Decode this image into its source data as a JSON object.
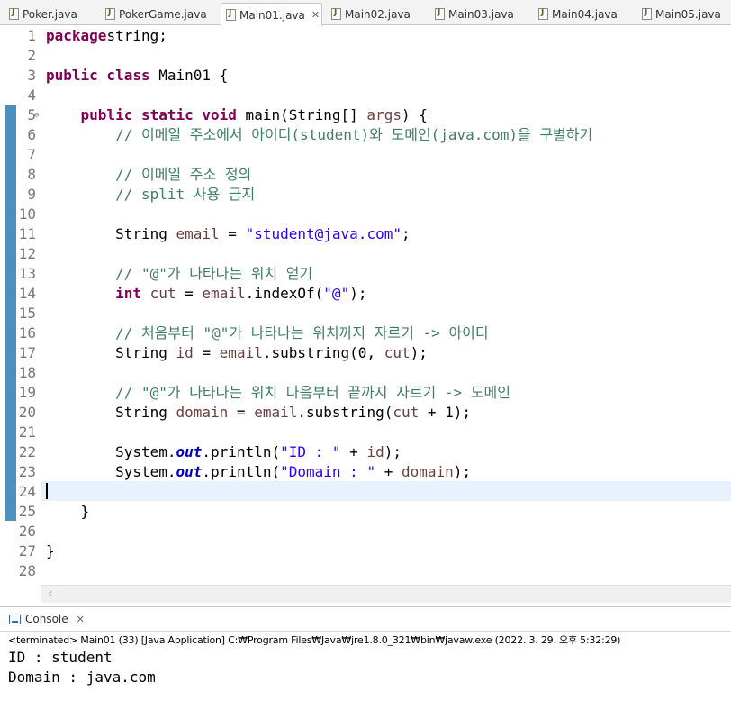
{
  "tabs": [
    {
      "label": "Poker.java",
      "active": false
    },
    {
      "label": "PokerGame.java",
      "active": false
    },
    {
      "label": "Main01.java",
      "active": true
    },
    {
      "label": "Main02.java",
      "active": false
    },
    {
      "label": "Main03.java",
      "active": false
    },
    {
      "label": "Main04.java",
      "active": false
    },
    {
      "label": "Main05.java",
      "active": false
    }
  ],
  "tab_close_glyph": "✕",
  "editor": {
    "fold_marker": "⊖",
    "lines": [
      {
        "n": "1",
        "t": [
          [
            "kw",
            "package"
          ],
          [
            "",
            "string;"
          ]
        ]
      },
      {
        "n": "2",
        "t": []
      },
      {
        "n": "3",
        "t": [
          [
            "kw",
            "public class"
          ],
          [
            "",
            " Main01 {"
          ]
        ]
      },
      {
        "n": "4",
        "t": []
      },
      {
        "n": "5",
        "fold": true,
        "t": [
          [
            "",
            "    "
          ],
          [
            "kw",
            "public static void"
          ],
          [
            "",
            " main(String[] "
          ],
          [
            "vr",
            "args"
          ],
          [
            "",
            ") {"
          ]
        ]
      },
      {
        "n": "6",
        "t": [
          [
            "",
            "        "
          ],
          [
            "cm",
            "// 이메일 주소에서 아이디(student)와 도메인(java.com)을 구별하기"
          ]
        ]
      },
      {
        "n": "7",
        "t": []
      },
      {
        "n": "8",
        "t": [
          [
            "",
            "        "
          ],
          [
            "cm",
            "// 이메일 주소 정의"
          ]
        ]
      },
      {
        "n": "9",
        "t": [
          [
            "",
            "        "
          ],
          [
            "cm",
            "// split 사용 금지"
          ]
        ]
      },
      {
        "n": "10",
        "t": []
      },
      {
        "n": "11",
        "t": [
          [
            "",
            "        String "
          ],
          [
            "vr",
            "email"
          ],
          [
            "",
            " = "
          ],
          [
            "st",
            "\"student@java.com\""
          ],
          [
            "",
            ";"
          ]
        ]
      },
      {
        "n": "12",
        "t": []
      },
      {
        "n": "13",
        "t": [
          [
            "",
            "        "
          ],
          [
            "cm",
            "// \"@\"가 나타나는 위치 얻기"
          ]
        ]
      },
      {
        "n": "14",
        "t": [
          [
            "",
            "        "
          ],
          [
            "kw",
            "int"
          ],
          [
            "",
            " "
          ],
          [
            "vr",
            "cut"
          ],
          [
            "",
            " = "
          ],
          [
            "vr",
            "email"
          ],
          [
            "",
            ".indexOf("
          ],
          [
            "st",
            "\"@\""
          ],
          [
            "",
            ");"
          ]
        ]
      },
      {
        "n": "15",
        "t": []
      },
      {
        "n": "16",
        "t": [
          [
            "",
            "        "
          ],
          [
            "cm",
            "// 처음부터 \"@\"가 나타나는 위치까지 자르기 -> 아이디"
          ]
        ]
      },
      {
        "n": "17",
        "t": [
          [
            "",
            "        String "
          ],
          [
            "vr",
            "id"
          ],
          [
            "",
            " = "
          ],
          [
            "vr",
            "email"
          ],
          [
            "",
            ".substring(0, "
          ],
          [
            "vr",
            "cut"
          ],
          [
            "",
            ");"
          ]
        ]
      },
      {
        "n": "18",
        "t": []
      },
      {
        "n": "19",
        "t": [
          [
            "",
            "        "
          ],
          [
            "cm",
            "// \"@\"가 나타나는 위치 다음부터 끝까지 자르기 -> 도메인"
          ]
        ]
      },
      {
        "n": "20",
        "t": [
          [
            "",
            "        String "
          ],
          [
            "vr",
            "domain"
          ],
          [
            "",
            " = "
          ],
          [
            "vr",
            "email"
          ],
          [
            "",
            ".substring("
          ],
          [
            "vr",
            "cut"
          ],
          [
            "",
            " + 1);"
          ]
        ]
      },
      {
        "n": "21",
        "t": []
      },
      {
        "n": "22",
        "t": [
          [
            "",
            "        System."
          ],
          [
            "fd",
            "out"
          ],
          [
            "",
            ".println("
          ],
          [
            "st",
            "\"ID : \""
          ],
          [
            "",
            " + "
          ],
          [
            "vr",
            "id"
          ],
          [
            "",
            ");"
          ]
        ]
      },
      {
        "n": "23",
        "t": [
          [
            "",
            "        System."
          ],
          [
            "fd",
            "out"
          ],
          [
            "",
            ".println("
          ],
          [
            "st",
            "\"Domain : \""
          ],
          [
            "",
            " + "
          ],
          [
            "vr",
            "domain"
          ],
          [
            "",
            ");"
          ]
        ]
      },
      {
        "n": "24",
        "t": []
      },
      {
        "n": "25",
        "t": [
          [
            "",
            "    }"
          ]
        ]
      },
      {
        "n": "26",
        "t": []
      },
      {
        "n": "27",
        "t": [
          [
            "",
            "}"
          ]
        ]
      },
      {
        "n": "28",
        "t": []
      }
    ]
  },
  "hscroll_arrow": "‹",
  "console": {
    "title": "Console",
    "close_glyph": "✕",
    "status": "<terminated> Main01 (33) [Java Application] C:₩Program Files₩Java₩jre1.8.0_321₩bin₩javaw.exe  (2022. 3. 29. 오후 5:32:29)",
    "output": [
      "ID : student",
      "Domain : java.com"
    ]
  },
  "colors": {
    "keyword": "#7f0055",
    "comment": "#3f7f5f",
    "string": "#2a00ff",
    "variable": "#6a3e3e",
    "static_field": "#0000c0",
    "ruler": "#4d8fbe",
    "current_line": "#e8f2fe"
  }
}
